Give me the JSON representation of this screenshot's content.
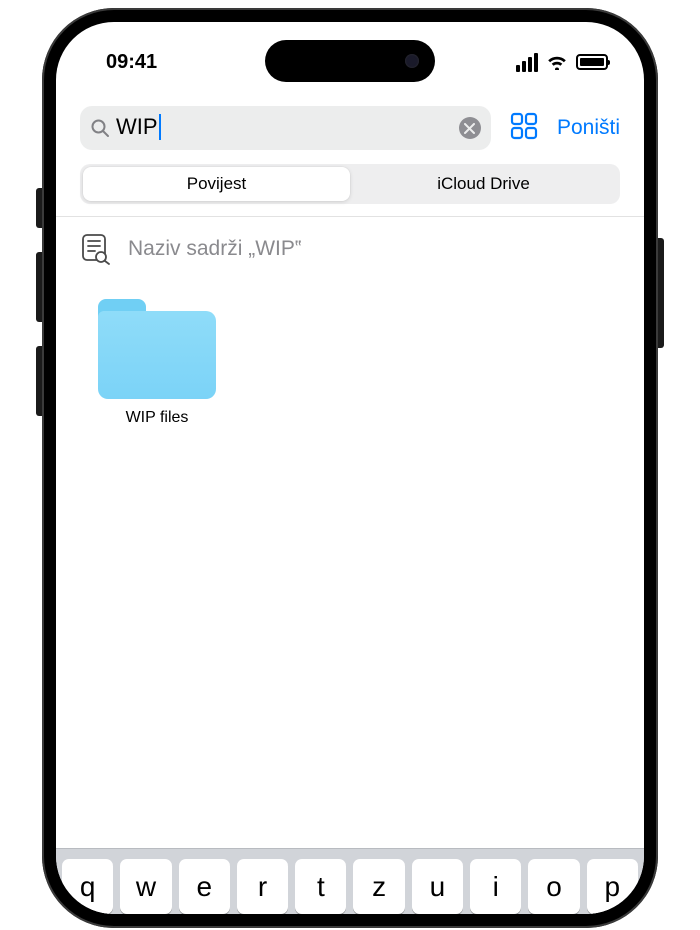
{
  "status": {
    "time": "09:41"
  },
  "search": {
    "query": "WIP",
    "cancel_label": "Poništi"
  },
  "tabs": {
    "history": "Povijest",
    "icloud": "iCloud Drive",
    "selected": "history"
  },
  "suggestion": {
    "text": "Naziv sadrži „WIP‟"
  },
  "results": {
    "items": [
      {
        "name": "WIP files",
        "type": "folder"
      }
    ]
  },
  "keyboard": {
    "row1": [
      "q",
      "w",
      "e",
      "r",
      "t",
      "z",
      "u",
      "i",
      "o",
      "p"
    ]
  },
  "colors": {
    "accent": "#007aff",
    "folder": "#7bd3f7"
  }
}
